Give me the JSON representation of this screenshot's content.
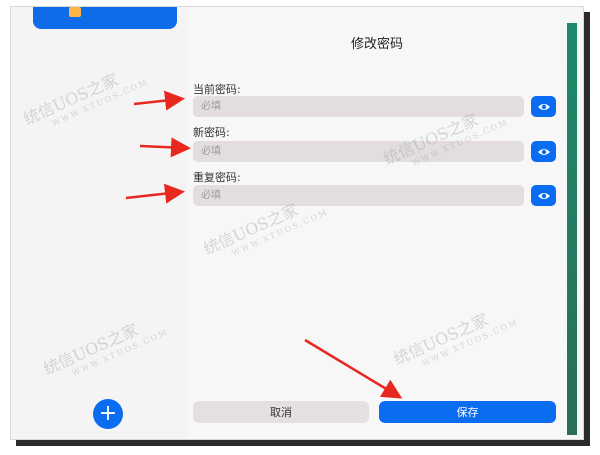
{
  "dialog": {
    "title": "修改密码",
    "fields": [
      {
        "label": "当前密码:",
        "placeholder": "必填"
      },
      {
        "label": "新密码:",
        "placeholder": "必填"
      },
      {
        "label": "重复密码:",
        "placeholder": "必填"
      }
    ],
    "cancel_label": "取消",
    "save_label": "保存"
  },
  "sidebar": {
    "add_label": "+"
  },
  "watermark": {
    "text": "统信UOS之家",
    "url": "WWW.XTUOS.COM"
  },
  "colors": {
    "accent": "#0a6cf1",
    "annotation_arrow": "#e8281f"
  }
}
